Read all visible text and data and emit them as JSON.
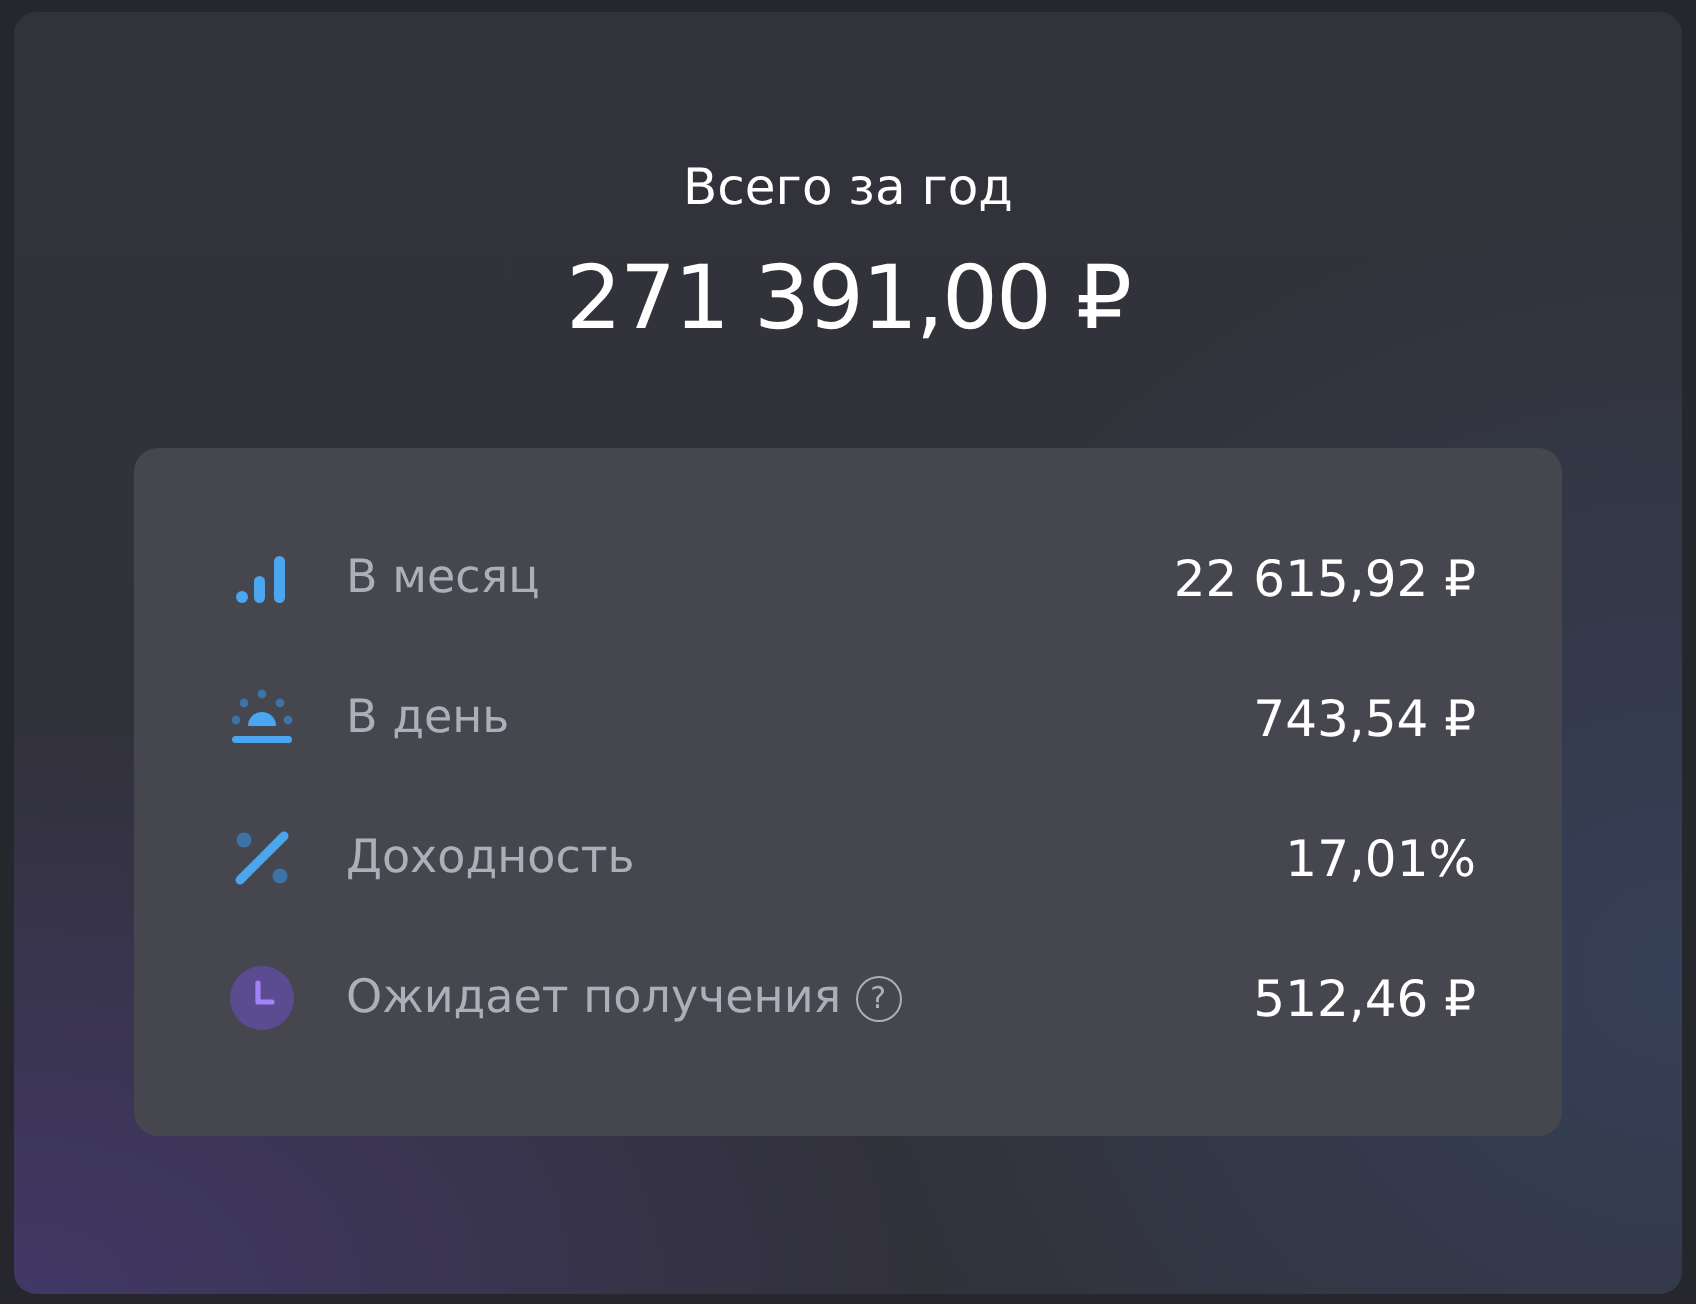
{
  "summary": {
    "title": "Всего за год",
    "total": "271 391,00 ₽"
  },
  "stats": [
    {
      "kind": "bars",
      "label": "В месяц",
      "value": "22 615,92 ₽"
    },
    {
      "kind": "sunrise",
      "label": "В день",
      "value": "743,54 ₽"
    },
    {
      "kind": "percent",
      "label": "Доходность",
      "value": "17,01%"
    },
    {
      "kind": "clock",
      "label": "Ожидает получения",
      "hint": "?",
      "value": "512,46 ₽"
    }
  ]
}
